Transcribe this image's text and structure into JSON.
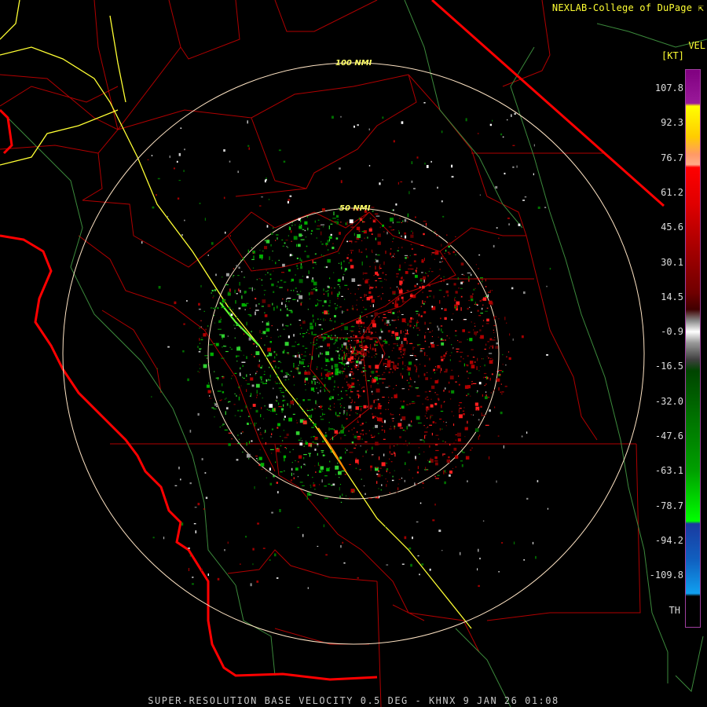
{
  "credit": "NEXLAB-College of DuPage",
  "credit_icon": "external-link-icon",
  "product": "VEL",
  "units": "[KT]",
  "footer": "SUPER-RESOLUTION BASE VELOCITY 0.5 DEG - KHNX 9 JAN 26 01:08",
  "ring_labels": {
    "outer": "100 NMI",
    "inner": "50 NMI"
  },
  "scale_labels": [
    "107.8",
    "92.3",
    "76.7",
    "61.2",
    "45.6",
    "30.1",
    "14.5",
    "-0.9",
    "-16.5",
    "-32.0",
    "-47.6",
    "-63.1",
    "-78.7",
    "-94.2",
    "-109.8",
    "TH"
  ],
  "colors": {
    "background": "#000000",
    "borders": "#cc0000",
    "coast": "#ff0000",
    "highway": "#ffff33",
    "rivers": "#3c8a3c",
    "rings": "#ffe4c4"
  }
}
